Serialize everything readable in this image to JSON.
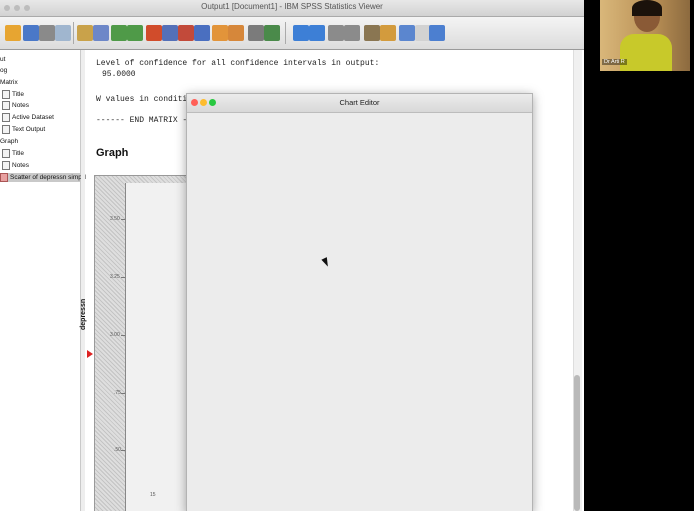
{
  "window": {
    "title": "Output1 [Document1] - IBM SPSS Statistics Viewer"
  },
  "toolbar": {
    "icons": [
      "open-folder-icon",
      "save-icon",
      "print-icon",
      "print-preview-icon",
      "export-icon",
      "recall-dialog-icon",
      "undo-icon",
      "redo-icon",
      "goto-data-icon",
      "goto-case-icon",
      "goto-variable-icon",
      "variables-icon",
      "insert-output-icon",
      "select-last-output-icon",
      "designate-window-icon",
      "chart-icon",
      "back-arrow-icon",
      "forward-arrow-icon",
      "expand-icon",
      "collapse-icon",
      "show-icon",
      "hide-icon",
      "insert-heading-icon",
      "insert-title-icon",
      "insert-text-icon"
    ]
  },
  "outline": {
    "items": [
      {
        "label": "ut",
        "indent": 0
      },
      {
        "label": "og",
        "indent": 0
      },
      {
        "label": "Matrix",
        "indent": 0
      },
      {
        "label": "Title",
        "indent": 1
      },
      {
        "label": "Notes",
        "indent": 1
      },
      {
        "label": "Active Dataset",
        "indent": 1
      },
      {
        "label": "Text Output",
        "indent": 1
      },
      {
        "label": "Graph",
        "indent": 0
      },
      {
        "label": "Title",
        "indent": 1
      },
      {
        "label": "Notes",
        "indent": 1
      },
      {
        "label": "Scatter of depressn simpl by",
        "indent": 1,
        "selected": true
      }
    ]
  },
  "output": {
    "line1": "Level of confidence for all confidence intervals in output:",
    "line2": "95.0000",
    "line3": "W values in conditional tabl",
    "line4": "------ END MATRIX -----",
    "graph_heading": "Graph"
  },
  "chart_preview": {
    "ylabel": "depressn",
    "yticks": [
      "3.50",
      "3.25",
      "3.00",
      ".75",
      ".50"
    ],
    "xtick": "15"
  },
  "chart_editor": {
    "title": "Chart Editor"
  },
  "webcam": {
    "name_label": "Dr Arti R"
  },
  "colors": {
    "close": "#ff5f57",
    "minimize": "#febc2e",
    "zoom": "#28c840"
  }
}
